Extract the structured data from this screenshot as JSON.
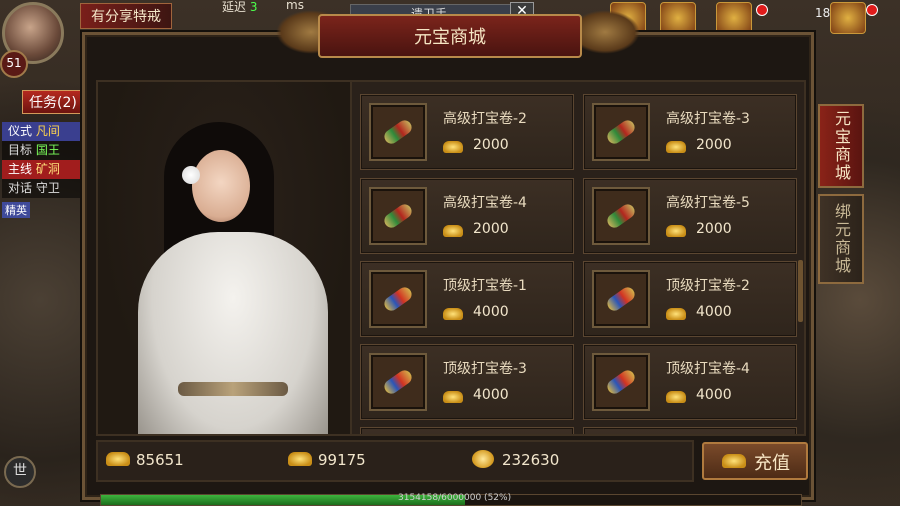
{
  "hud": {
    "title": "有分享特戒",
    "delay_label": "延迟",
    "delay_value": "3",
    "delay_unit": "ms",
    "level": "51",
    "quest_tab": "任务(2)",
    "quests": [
      {
        "tag": "仪式",
        "value": "凡间"
      },
      {
        "tag": "目标",
        "value": "国王"
      },
      {
        "tag": "主线",
        "value": "矿洞"
      },
      {
        "tag": "对话",
        "value": "守卫"
      }
    ],
    "tiny_text": "精英",
    "clock": "18",
    "exp_text": "3154158/6000000 (52%)",
    "exp_progress": 0.52,
    "mic_label": "世"
  },
  "modal": {
    "title": "元宝商城",
    "behind_title": "遗卫手",
    "close_label": "✕",
    "tabs": [
      {
        "label": "元宝商城",
        "active": true
      },
      {
        "label": "绑元商城",
        "active": false
      }
    ],
    "items": [
      {
        "name": "高级打宝卷-2",
        "price": "2000",
        "icon": "green-scroll-icon"
      },
      {
        "name": "高级打宝卷-3",
        "price": "2000",
        "icon": "green-scroll-icon"
      },
      {
        "name": "高级打宝卷-4",
        "price": "2000",
        "icon": "green-scroll-icon"
      },
      {
        "name": "高级打宝卷-5",
        "price": "2000",
        "icon": "green-scroll-icon"
      },
      {
        "name": "顶级打宝卷-1",
        "price": "4000",
        "icon": "blue-scroll-icon"
      },
      {
        "name": "顶级打宝卷-2",
        "price": "4000",
        "icon": "blue-scroll-icon"
      },
      {
        "name": "顶级打宝卷-3",
        "price": "4000",
        "icon": "blue-scroll-icon"
      },
      {
        "name": "顶级打宝卷-4",
        "price": "4000",
        "icon": "blue-scroll-icon"
      }
    ],
    "currency": {
      "yuanbao": "85651",
      "bound_yuanbao": "99175",
      "gold": "232630"
    },
    "recharge_label": "充值"
  },
  "colors": {
    "title_red": "#7b241b",
    "frame_gold": "#b88a4a",
    "text_cream": "#e9dbbf"
  }
}
